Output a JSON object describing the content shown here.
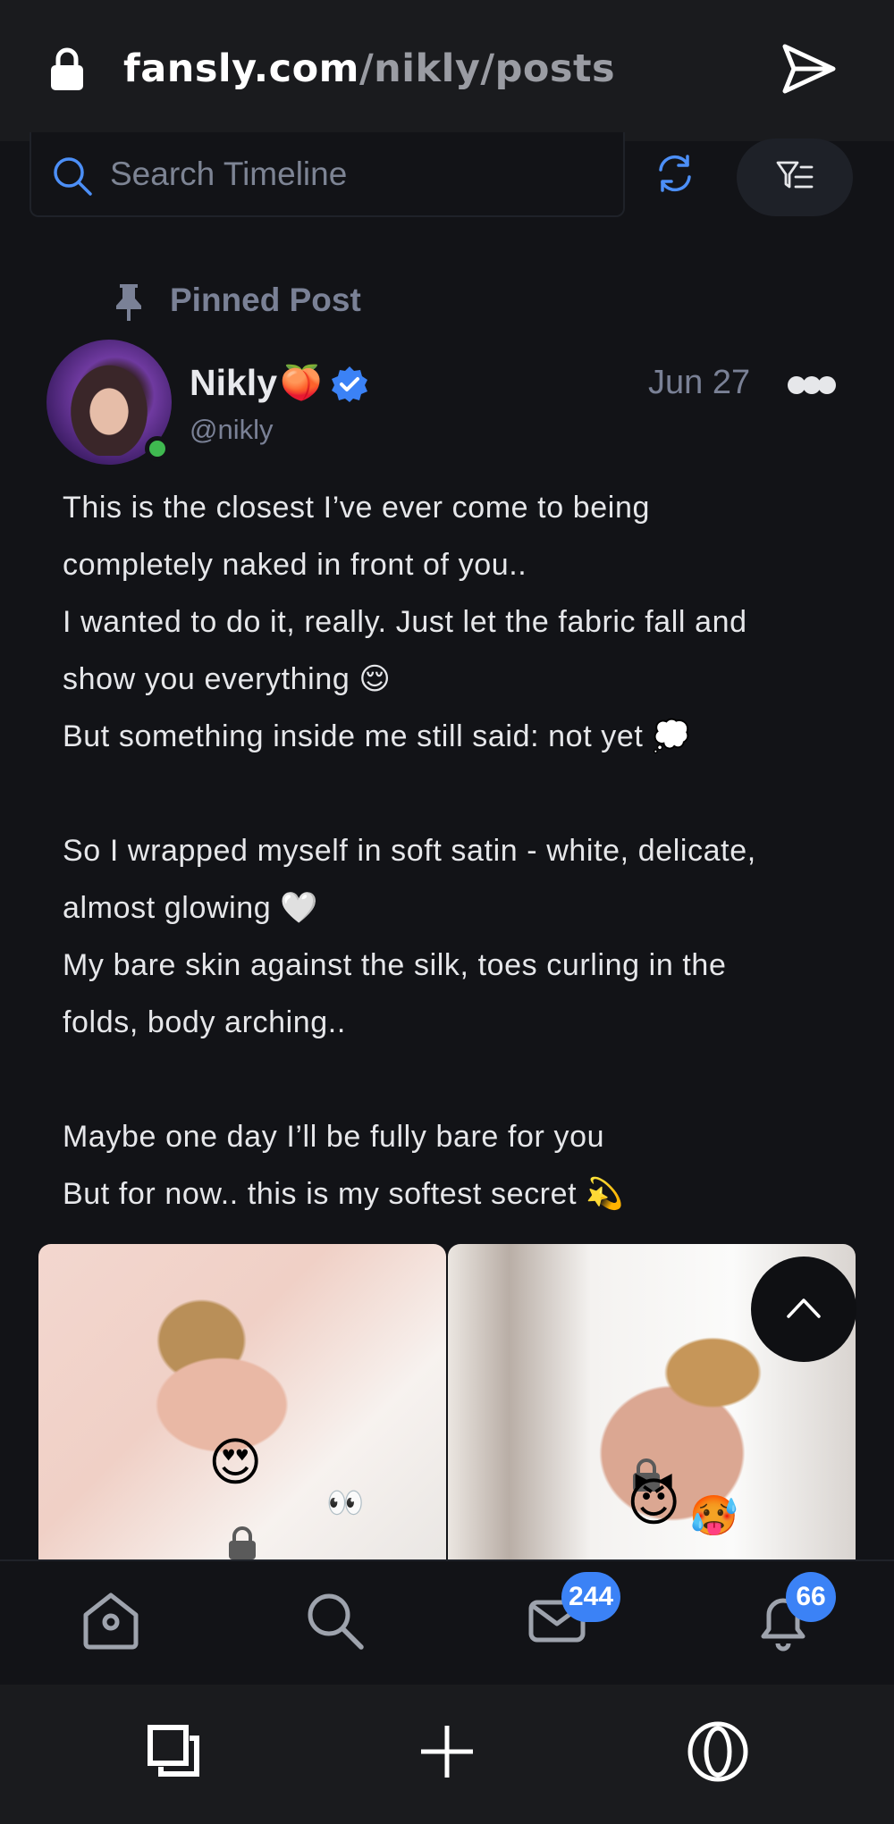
{
  "browser": {
    "url_host": "fansly.com",
    "url_path": "/nikly/posts"
  },
  "search": {
    "placeholder": "Search Timeline"
  },
  "pinned": {
    "label": "Pinned Post"
  },
  "post": {
    "author_name": "Nikly",
    "author_emoji": "🍑",
    "handle": "@nikly",
    "date": "Jun 27",
    "lines": [
      "This is the closest I’ve ever come to being",
      "completely naked in front of you..",
      "I wanted to do it, really. Just let the fabric fall and",
      "show you everything 😌",
      "But something inside me still said: not yet 💭",
      "",
      "So I wrapped myself in soft satin - white, delicate,",
      "almost glowing 🤍",
      "My bare skin against the silk, toes curling in the",
      "folds, body arching..",
      "",
      "Maybe one day I’ll be fully bare for you",
      "But for now.. this is my softest secret 💫"
    ],
    "media_stickers": [
      "😍",
      "👀",
      "😈",
      "🥵"
    ]
  },
  "nav": {
    "messages_badge": "244",
    "notifications_badge": "66"
  },
  "colors": {
    "background": "#121317",
    "accent": "#3b82f6",
    "muted": "#7a8196"
  }
}
